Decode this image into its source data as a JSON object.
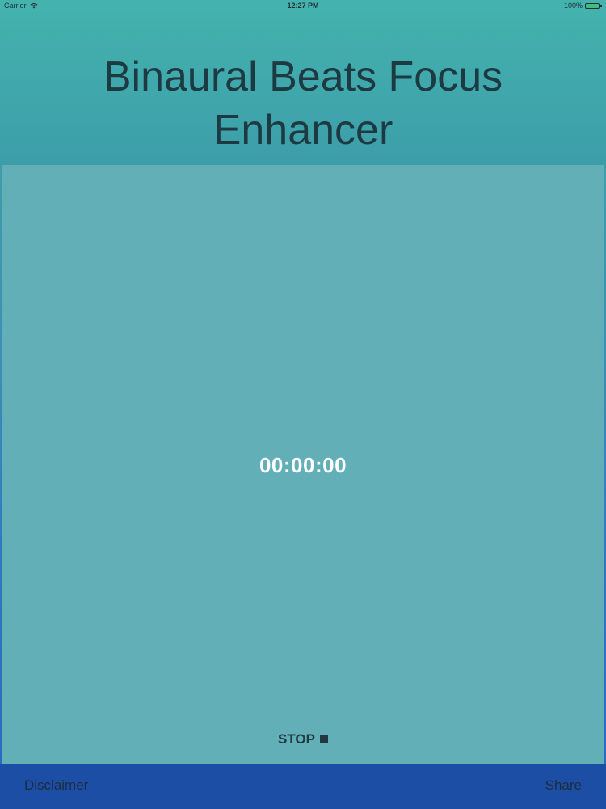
{
  "status_bar": {
    "carrier": "Carrier",
    "time": "12:27 PM",
    "battery_text": "100%",
    "battery_level": 1.0,
    "battery_color": "#3fc94c"
  },
  "app": {
    "title_line1": "Binaural Beats Focus",
    "title_line2": "Enhancer"
  },
  "main": {
    "timer": "00:00:00",
    "stop_label": "STOP",
    "stop_icon": "stop-square-icon"
  },
  "toolbar": {
    "disclaimer_label": "Disclaimer",
    "share_label": "Share"
  },
  "colors": {
    "panel": "#62afb8",
    "toolbar": "#1c4ea5",
    "title_text": "#1d3a43"
  }
}
